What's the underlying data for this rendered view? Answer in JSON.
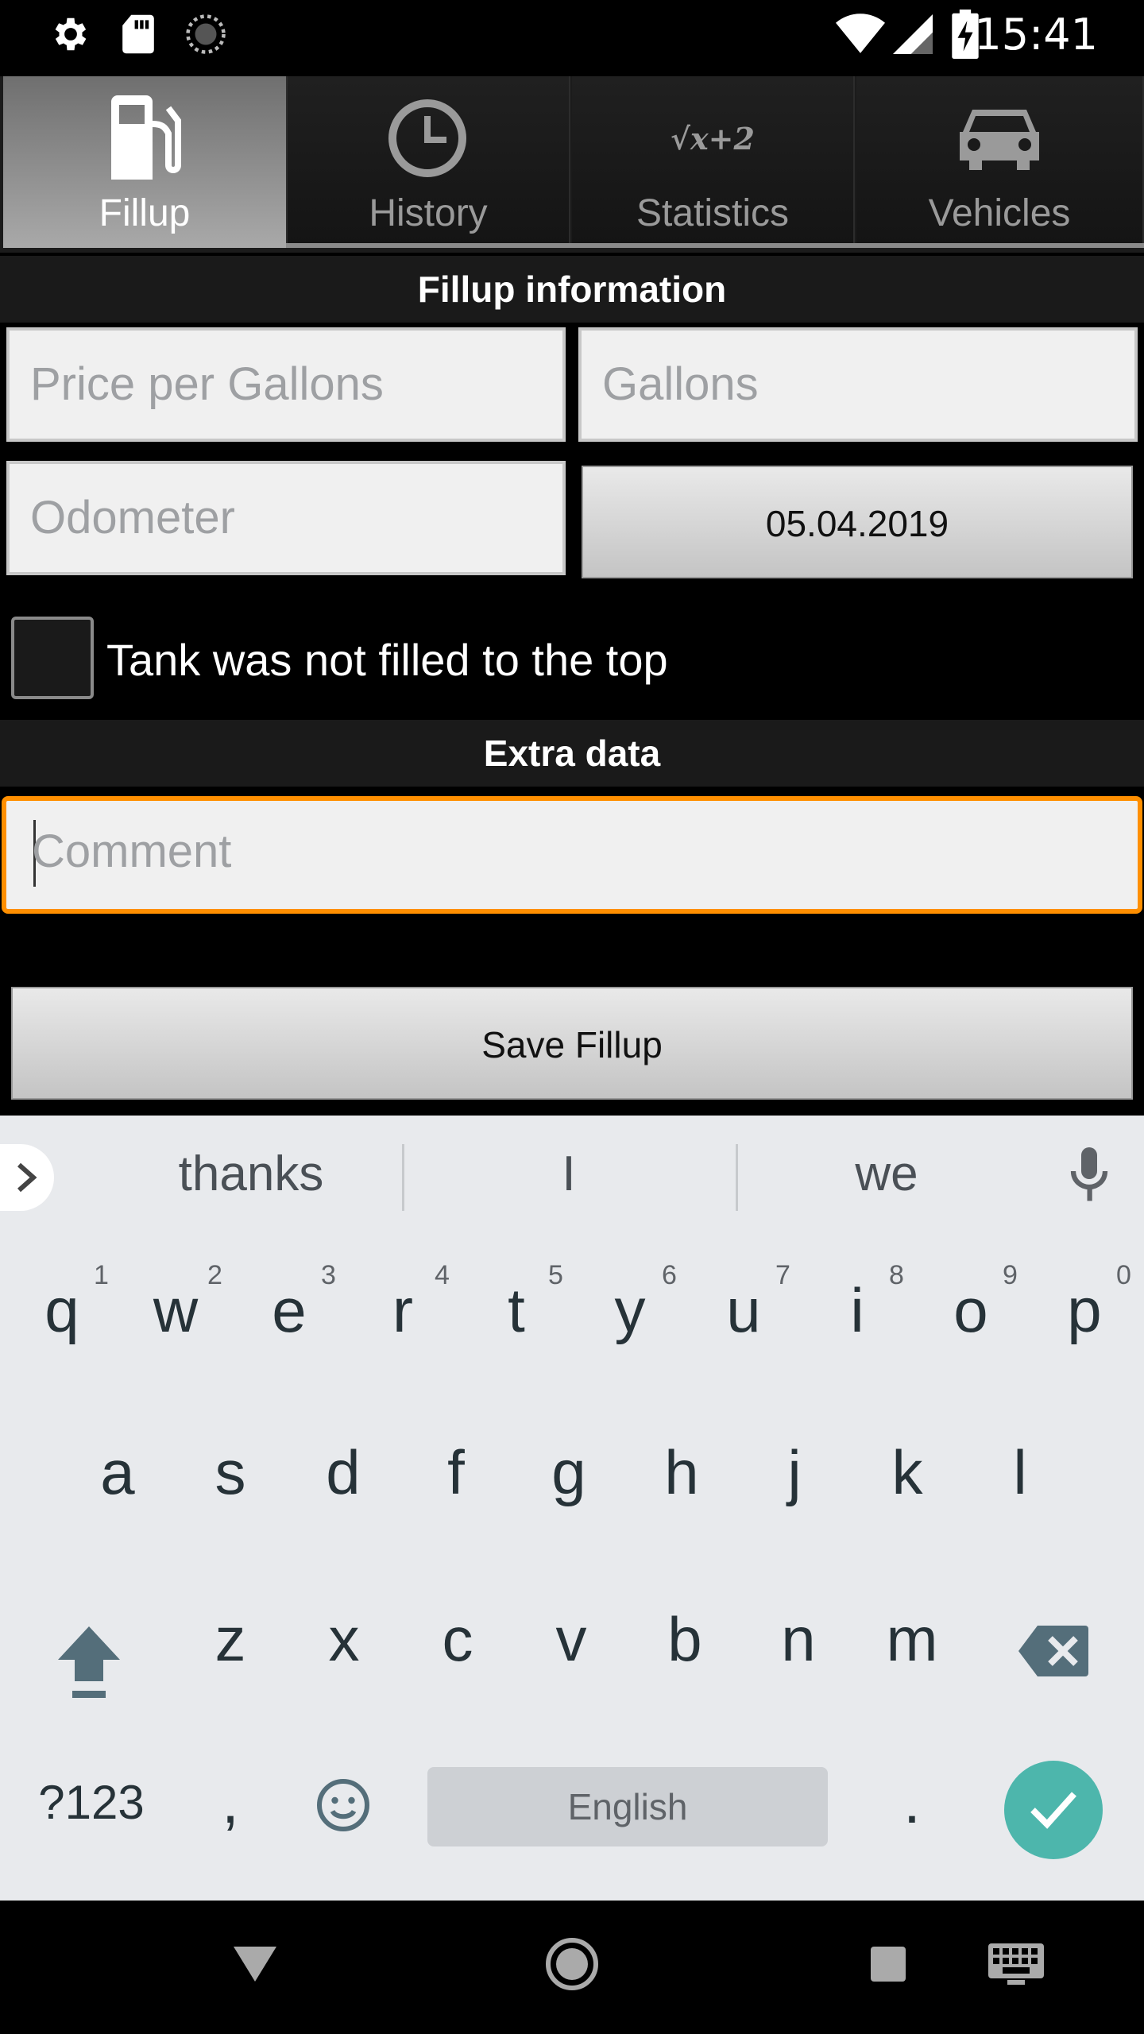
{
  "status_bar": {
    "time": "15:41",
    "icons": [
      "gear-icon",
      "sd-card-icon",
      "sync-icon",
      "wifi-icon",
      "signal-icon",
      "battery-charging-icon"
    ]
  },
  "tabs": [
    {
      "label": "Fillup",
      "icon": "fuel-pump-icon",
      "active": true
    },
    {
      "label": "History",
      "icon": "clock-icon",
      "active": false
    },
    {
      "label": "Statistics",
      "icon": "formula-icon",
      "active": false
    },
    {
      "label": "Vehicles",
      "icon": "car-icon",
      "active": false
    }
  ],
  "statistics_icon_text": "√x+2",
  "fillup": {
    "section_title": "Fillup information",
    "price_placeholder": "Price per Gallons",
    "gallons_placeholder": "Gallons",
    "odometer_placeholder": "Odometer",
    "date_value": "05.04.2019",
    "tank_checkbox_label": "Tank was not filled to the top",
    "tank_checkbox_checked": false
  },
  "extra": {
    "section_title": "Extra data",
    "comment_placeholder": "Comment"
  },
  "save_button_label": "Save Fillup",
  "keyboard": {
    "suggestions": [
      "thanks",
      "I",
      "we"
    ],
    "row1": [
      "q",
      "w",
      "e",
      "r",
      "t",
      "y",
      "u",
      "i",
      "o",
      "p"
    ],
    "row1_hints": [
      "1",
      "2",
      "3",
      "4",
      "5",
      "6",
      "7",
      "8",
      "9",
      "0"
    ],
    "row2": [
      "a",
      "s",
      "d",
      "f",
      "g",
      "h",
      "j",
      "k",
      "l"
    ],
    "row3": [
      "z",
      "x",
      "c",
      "v",
      "b",
      "n",
      "m"
    ],
    "symbols_key": "?123",
    "comma_key": ",",
    "space_label": "English",
    "period_key": ".",
    "accent_color": "#4db6ac"
  },
  "colors": {
    "focus_border": "#ff8f00",
    "active_tab": "#9a9a9a"
  }
}
